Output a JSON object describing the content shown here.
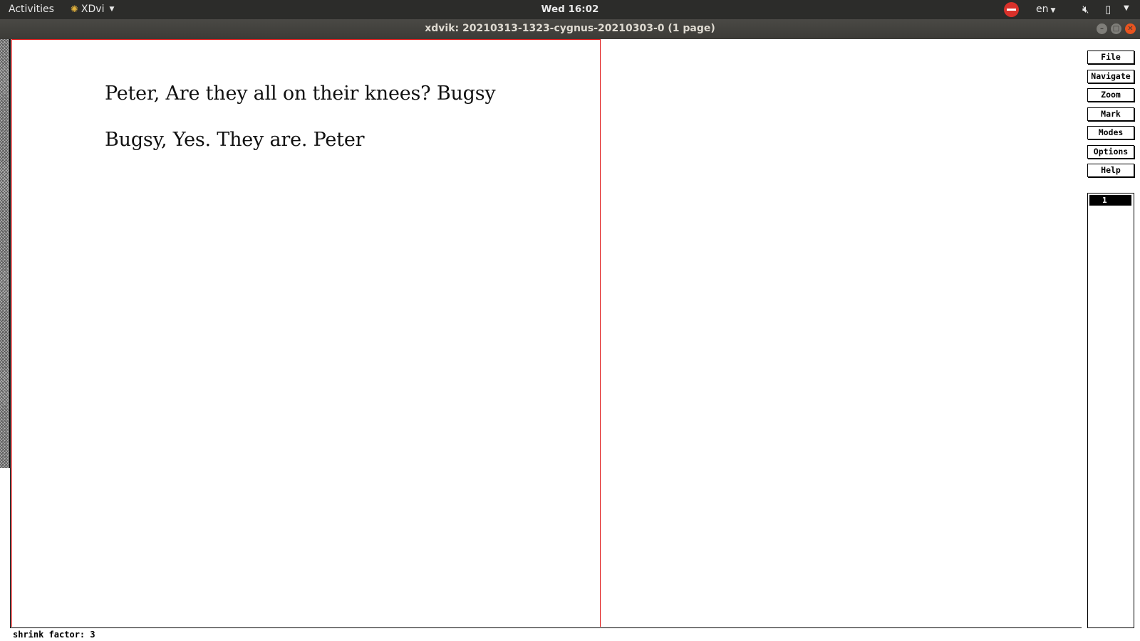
{
  "topbar": {
    "activities": "Activities",
    "app_name": "XDvi",
    "clock": "Wed 16:02",
    "lang": "en"
  },
  "window": {
    "title": "xdvik:  20210313-1323-cygnus-20210303-0   (1 page)"
  },
  "document": {
    "lines": [
      "Peter, Are they all on their knees? Bugsy",
      "Bugsy, Yes. They are. Peter"
    ]
  },
  "statusbar": {
    "text": "shrink factor: 3"
  },
  "panel": {
    "buttons": [
      "File",
      "Navigate",
      "Zoom",
      "Mark",
      "Modes",
      "Options",
      "Help"
    ],
    "pages": [
      "1"
    ]
  },
  "colors": {
    "page_border": "#e01b1b",
    "topbar_bg": "#2c2c2a",
    "close_button": "#e9541f"
  }
}
